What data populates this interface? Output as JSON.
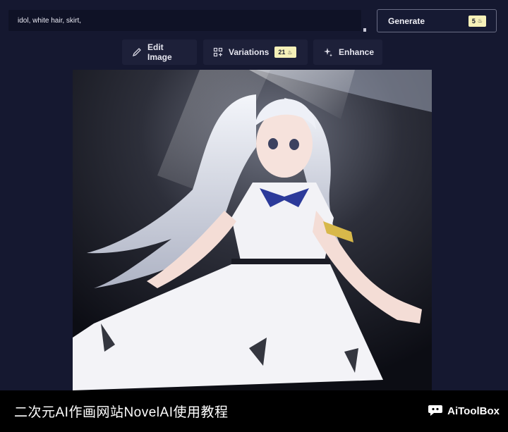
{
  "prompt": {
    "value": "idol, white hair, skirt,"
  },
  "generate": {
    "label": "Generate",
    "cost": "5"
  },
  "toolbar": {
    "edit_label": "Edit Image",
    "variations_label": "Variations",
    "variations_cost": "21",
    "enhance_label": "Enhance"
  },
  "image": {
    "alt": "Generated anime illustration: girl with long white hair in white dress with blue bow"
  },
  "caption": {
    "text": "二次元AI作画网站NovelAI使用教程"
  },
  "brand": {
    "name": "AiToolBox"
  },
  "colors": {
    "background": "#151830",
    "badge": "#f5f0b8",
    "caption_bar": "#000000"
  }
}
